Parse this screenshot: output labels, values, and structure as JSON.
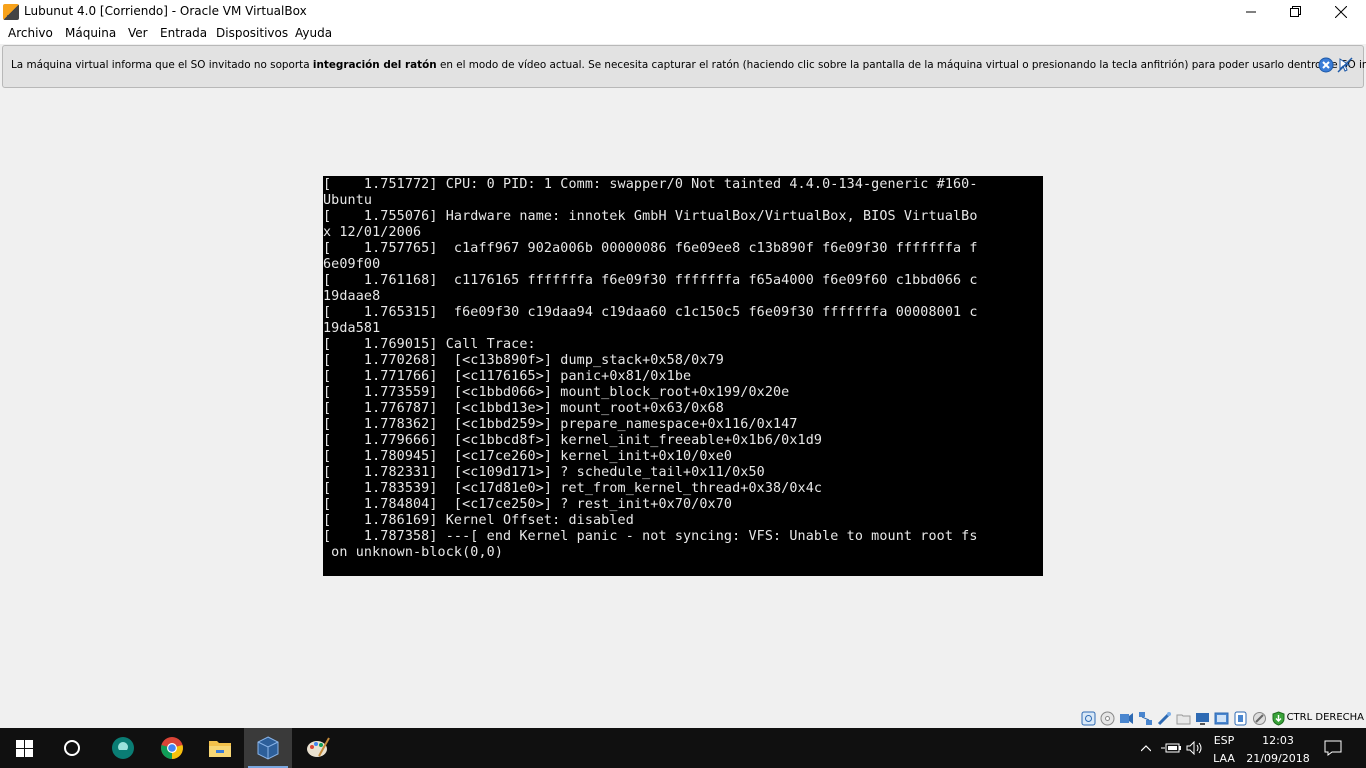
{
  "window": {
    "title": "Lubunut 4.0 [Corriendo] - Oracle VM VirtualBox"
  },
  "menu": [
    "Archivo",
    "Máquina",
    "Ver",
    "Entrada",
    "Dispositivos",
    "Ayuda"
  ],
  "notice": {
    "text_before": "La máquina virtual informa que el SO invitado no soporta ",
    "text_bold": "integración del ratón",
    "text_after": " en el modo de vídeo actual. Se necesita capturar el ratón (haciendo clic sobre la pantalla de la máquina virtual o presionando la tecla anfitrión) para poder usarlo dentro de SO invitado."
  },
  "console": {
    "lines": [
      "[    1.751772] CPU: 0 PID: 1 Comm: swapper/0 Not tainted 4.4.0-134-generic #160-",
      "Ubuntu",
      "[    1.755076] Hardware name: innotek GmbH VirtualBox/VirtualBox, BIOS VirtualBo",
      "x 12/01/2006",
      "[    1.757765]  c1aff967 902a006b 00000086 f6e09ee8 c13b890f f6e09f30 fffffffa f",
      "6e09f00",
      "[    1.761168]  c1176165 fffffffa f6e09f30 fffffffa f65a4000 f6e09f60 c1bbd066 c",
      "19daae8",
      "[    1.765315]  f6e09f30 c19daa94 c19daa60 c1c150c5 f6e09f30 fffffffa 00008001 c",
      "19da581",
      "[    1.769015] Call Trace:",
      "[    1.770268]  [<c13b890f>] dump_stack+0x58/0x79",
      "[    1.771766]  [<c1176165>] panic+0x81/0x1be",
      "[    1.773559]  [<c1bbd066>] mount_block_root+0x199/0x20e",
      "[    1.776787]  [<c1bbd13e>] mount_root+0x63/0x68",
      "[    1.778362]  [<c1bbd259>] prepare_namespace+0x116/0x147",
      "[    1.779666]  [<c1bbcd8f>] kernel_init_freeable+0x1b6/0x1d9",
      "[    1.780945]  [<c17ce260>] kernel_init+0x10/0xe0",
      "[    1.782331]  [<c109d171>] ? schedule_tail+0x11/0x50",
      "[    1.783539]  [<c17d81e0>] ret_from_kernel_thread+0x38/0x4c",
      "[    1.784804]  [<c17ce250>] ? rest_init+0x70/0x70",
      "[    1.786169] Kernel Offset: disabled",
      "[    1.787358] ---[ end Kernel panic - not syncing: VFS: Unable to mount root fs",
      " on unknown-block(0,0)"
    ]
  },
  "statusbar": {
    "host_key": "CTRL DERECHA",
    "icons": [
      "hard-disk-icon",
      "optical-drive-icon",
      "audio-icon",
      "network-icon",
      "usb-icon",
      "shared-folders-icon",
      "display-icon",
      "video-capture-icon",
      "recording-icon",
      "cpu-icon",
      "mouse-integration-icon",
      "keyboard-capture-icon"
    ]
  },
  "taskbar": {
    "apps": [
      "windows-start-icon",
      "cortana-search-icon",
      "gitkraken-icon",
      "chrome-icon",
      "file-explorer-icon",
      "virtualbox-icon",
      "paint-icon"
    ],
    "language_top": "ESP",
    "language_bottom": "LAA",
    "time": "12:03",
    "date": "21/09/2018"
  },
  "colors": {
    "console_bg": "#000000",
    "console_fg": "#e8e8e8",
    "taskbar_bg": "#101010",
    "notice_bg": "#e2e2e2"
  }
}
